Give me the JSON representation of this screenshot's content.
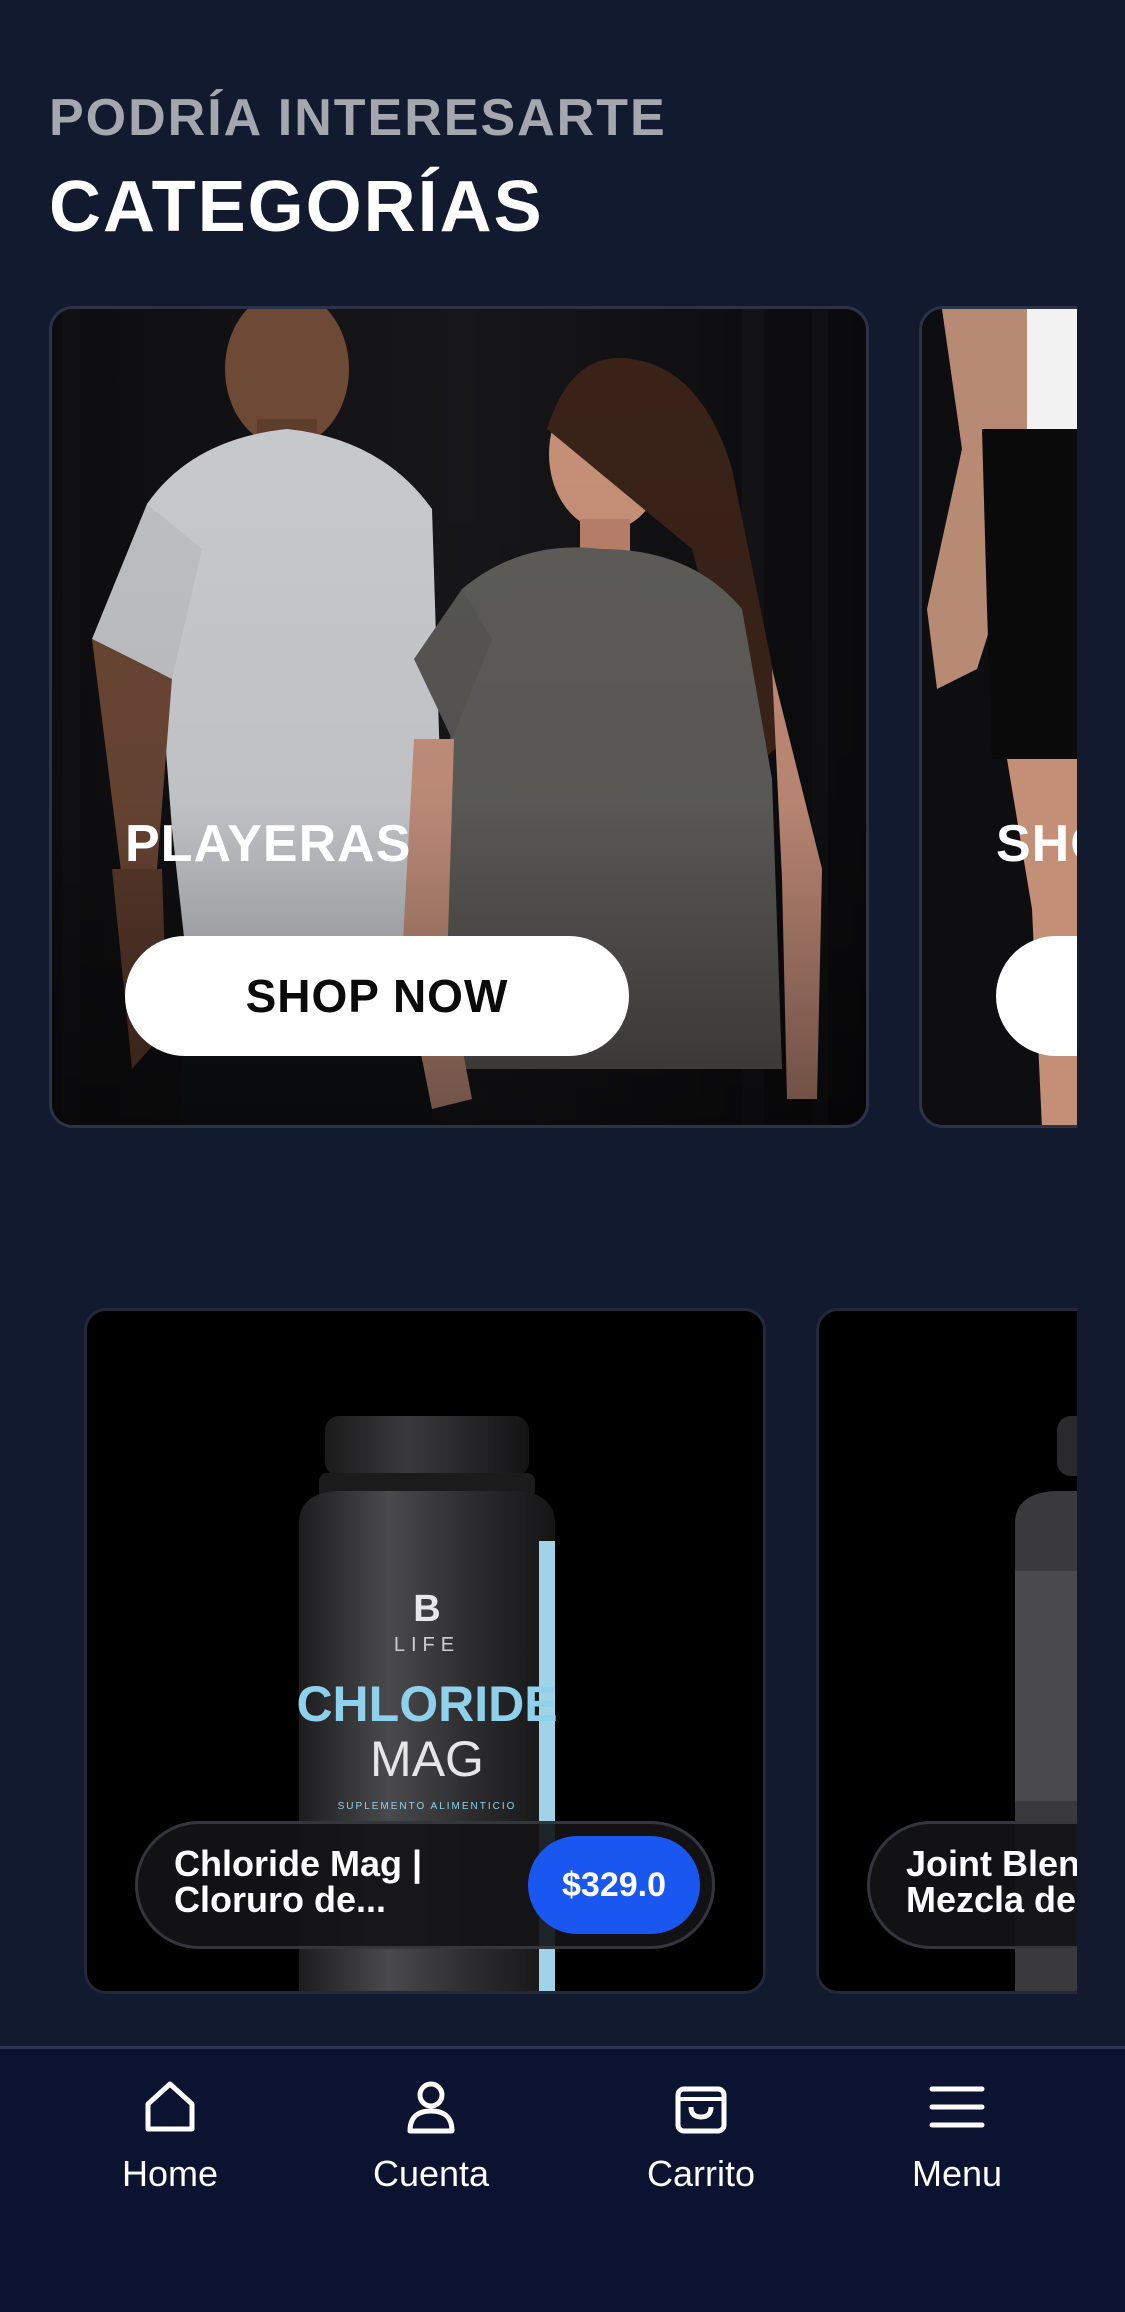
{
  "header": {
    "eyebrow": "PODRÍA INTERESARTE",
    "title": "CATEGORÍAS"
  },
  "categories": [
    {
      "label": "PLAYERAS",
      "button": "SHOP NOW"
    },
    {
      "label": "SHO",
      "button": ""
    }
  ],
  "products": [
    {
      "name": "Chloride Mag |\nCloruro de...",
      "price": "$329.0",
      "bottle_brand": "LIFE",
      "bottle_title_1": "CHLORIDE",
      "bottle_title_2": "MAG",
      "bottle_subtitle": "SUPLEMENTO ALIMENTICIO"
    },
    {
      "name": "Joint Blend\nMezcla de",
      "price": ""
    }
  ],
  "bottom_nav": [
    {
      "label": "Home",
      "icon": "home-icon"
    },
    {
      "label": "Cuenta",
      "icon": "user-icon"
    },
    {
      "label": "Carrito",
      "icon": "bag-icon"
    },
    {
      "label": "Menu",
      "icon": "menu-icon"
    }
  ],
  "colors": {
    "background": "#111a2e",
    "nav_background": "#0c1331",
    "price_accent": "#1a56f0",
    "eyebrow": "#a4a7ae"
  }
}
